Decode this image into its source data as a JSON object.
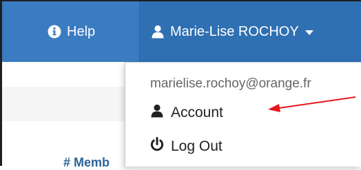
{
  "navbar": {
    "help_label": "Help",
    "user_label": "Marie-Lise ROCHOY",
    "bg_color": "#3a7cc1",
    "user_bg_color": "#2f70b3"
  },
  "dropdown": {
    "email": "marielise.rochoy@orange.fr",
    "items": [
      {
        "label": "Account",
        "icon": "user-icon"
      },
      {
        "label": "Log Out",
        "icon": "power-icon"
      }
    ]
  },
  "content": {
    "heading": "# Memb"
  },
  "annotation": {
    "arrow_color": "#e8151b"
  }
}
